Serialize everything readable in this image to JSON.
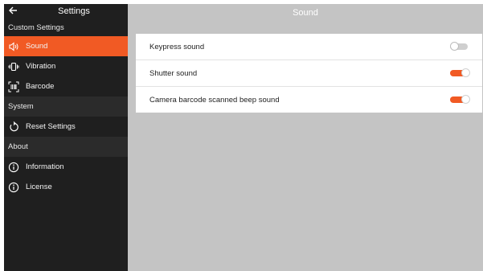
{
  "sidebar": {
    "title": "Settings",
    "sections": {
      "custom": "Custom Settings",
      "system": "System",
      "about": "About"
    },
    "items": {
      "sound": "Sound",
      "vibration": "Vibration",
      "barcode": "Barcode",
      "reset": "Reset Settings",
      "information": "Information",
      "license": "License"
    }
  },
  "main": {
    "title": "Sound",
    "settings": [
      {
        "label": "Keypress sound",
        "enabled": false
      },
      {
        "label": "Shutter sound",
        "enabled": true
      },
      {
        "label": "Camera barcode scanned beep sound",
        "enabled": true
      }
    ]
  },
  "colors": {
    "accent": "#f15a24",
    "sidebar_bg": "#1f1f1f",
    "main_bg": "#c4c4c4"
  }
}
